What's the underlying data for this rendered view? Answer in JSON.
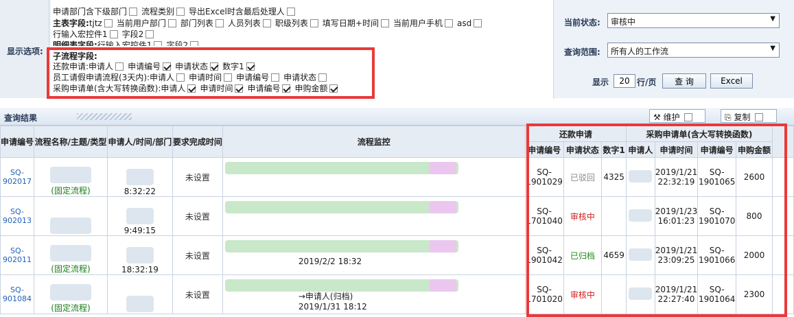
{
  "options": {
    "side_label": "显示选项:",
    "line1": [
      {
        "label": "申请部门含下级部门",
        "checked": false
      },
      {
        "label": "流程类别",
        "checked": false
      },
      {
        "label": "导出Excel时含最后处理人",
        "checked": false
      }
    ],
    "line2_title": "主表字段:",
    "line2": [
      {
        "label": "tjtz",
        "checked": false
      },
      {
        "label": "当前用户部门",
        "checked": false
      },
      {
        "label": "部门列表",
        "checked": false
      },
      {
        "label": "人员列表",
        "checked": false
      },
      {
        "label": "职级列表",
        "checked": false
      },
      {
        "label": "填写日期+时间",
        "checked": false
      },
      {
        "label": "当前用户手机",
        "checked": false
      },
      {
        "label": "asd",
        "checked": false
      }
    ],
    "line3": [
      {
        "label": "行输入宏控件1",
        "checked": false
      },
      {
        "label": "字段2",
        "checked": false
      }
    ],
    "line4_title": "明细表字段:",
    "line4": [
      {
        "label": "行输入宏控件1",
        "checked": false
      },
      {
        "label": "字段2",
        "checked": false
      }
    ],
    "sub_title": "子流程字段:",
    "sub_lines": [
      {
        "prefix": "还款申请:",
        "items": [
          {
            "label": "申请人",
            "checked": false
          },
          {
            "label": "申请编号",
            "checked": true
          },
          {
            "label": "申请状态",
            "checked": true
          },
          {
            "label": "数字1",
            "checked": true
          }
        ]
      },
      {
        "prefix": "员工请假申请流程(3天内):",
        "items": [
          {
            "label": "申请人",
            "checked": false
          },
          {
            "label": "申请时间",
            "checked": false
          },
          {
            "label": "申请编号",
            "checked": false
          },
          {
            "label": "申请状态",
            "checked": false
          }
        ]
      },
      {
        "prefix": "采购申请单(含大写转换函数):",
        "items": [
          {
            "label": "申请人",
            "checked": true
          },
          {
            "label": "申请时间",
            "checked": true
          },
          {
            "label": "申请编号",
            "checked": true
          },
          {
            "label": "申购金额",
            "checked": true
          }
        ]
      }
    ]
  },
  "right": {
    "status_label": "当前状态:",
    "status_value": "审核中",
    "range_label": "查询范围:",
    "range_value": "所有人的工作流",
    "display_label": "显示",
    "page_size": "20",
    "per_page": "行/页",
    "query_btn": "查 询",
    "excel_btn": "Excel"
  },
  "results": {
    "title": "查询结果",
    "maintain": "维护",
    "copy": "复制"
  },
  "table": {
    "headers": [
      "申请编号",
      "流程名称/主题/类型",
      "申请人/时间/部门",
      "要求完成时间",
      "流程监控"
    ],
    "group1": "还款申请",
    "group2": "采购申请单(含大写转换函数)",
    "sub_headers": [
      "申请编号",
      "申请状态",
      "数字1",
      "申请人",
      "申请时间",
      "申请编号",
      "申购金额"
    ],
    "rows": [
      {
        "id": "SQ-\n902017",
        "name_tag": "(固定流程)",
        "time": "8:32:22",
        "deadline": "未设置",
        "monitor": "",
        "g1_id": "SQ-\n1901029",
        "g1_status": "已驳回",
        "g1_status_color": "#888888",
        "g1_num": "4325",
        "g2_time": "2019/1/21\n22:32:19",
        "g2_id": "SQ-\n1901065",
        "g2_amount": "2600"
      },
      {
        "id": "SQ-\n902013",
        "name_tag": "",
        "time": "9:49:15",
        "deadline": "未设置",
        "monitor": "",
        "g1_id": "SQ-\n1701040",
        "g1_status": "审核中",
        "g1_status_color": "#d02020",
        "g1_num": "",
        "g2_time": "2019/1/23\n16:01:23",
        "g2_id": "SQ-\n1901070",
        "g2_amount": "800"
      },
      {
        "id": "SQ-\n902011",
        "name_tag": "(固定流程)",
        "time": "18:32:19",
        "deadline": "未设置",
        "monitor": "2019/2/2 18:32",
        "g1_id": "SQ-\n1901042",
        "g1_status": "已归档",
        "g1_status_color": "#1a8a1a",
        "g1_num": "4659",
        "g2_time": "2019/1/21\n23:09:25",
        "g2_id": "SQ-\n1901066",
        "g2_amount": "2000"
      },
      {
        "id": "SQ-\n901084",
        "name_tag": "(固定流程)",
        "time": "",
        "deadline": "未设置",
        "monitor": "→申请人(归档)\n2019/1/31 18:12",
        "g1_id": "SQ-\n1701020",
        "g1_status": "审核中",
        "g1_status_color": "#d02020",
        "g1_num": "",
        "g2_time": "2019/1/21\n22:27:40",
        "g2_id": "SQ-\n1901064",
        "g2_amount": "2300"
      }
    ]
  }
}
